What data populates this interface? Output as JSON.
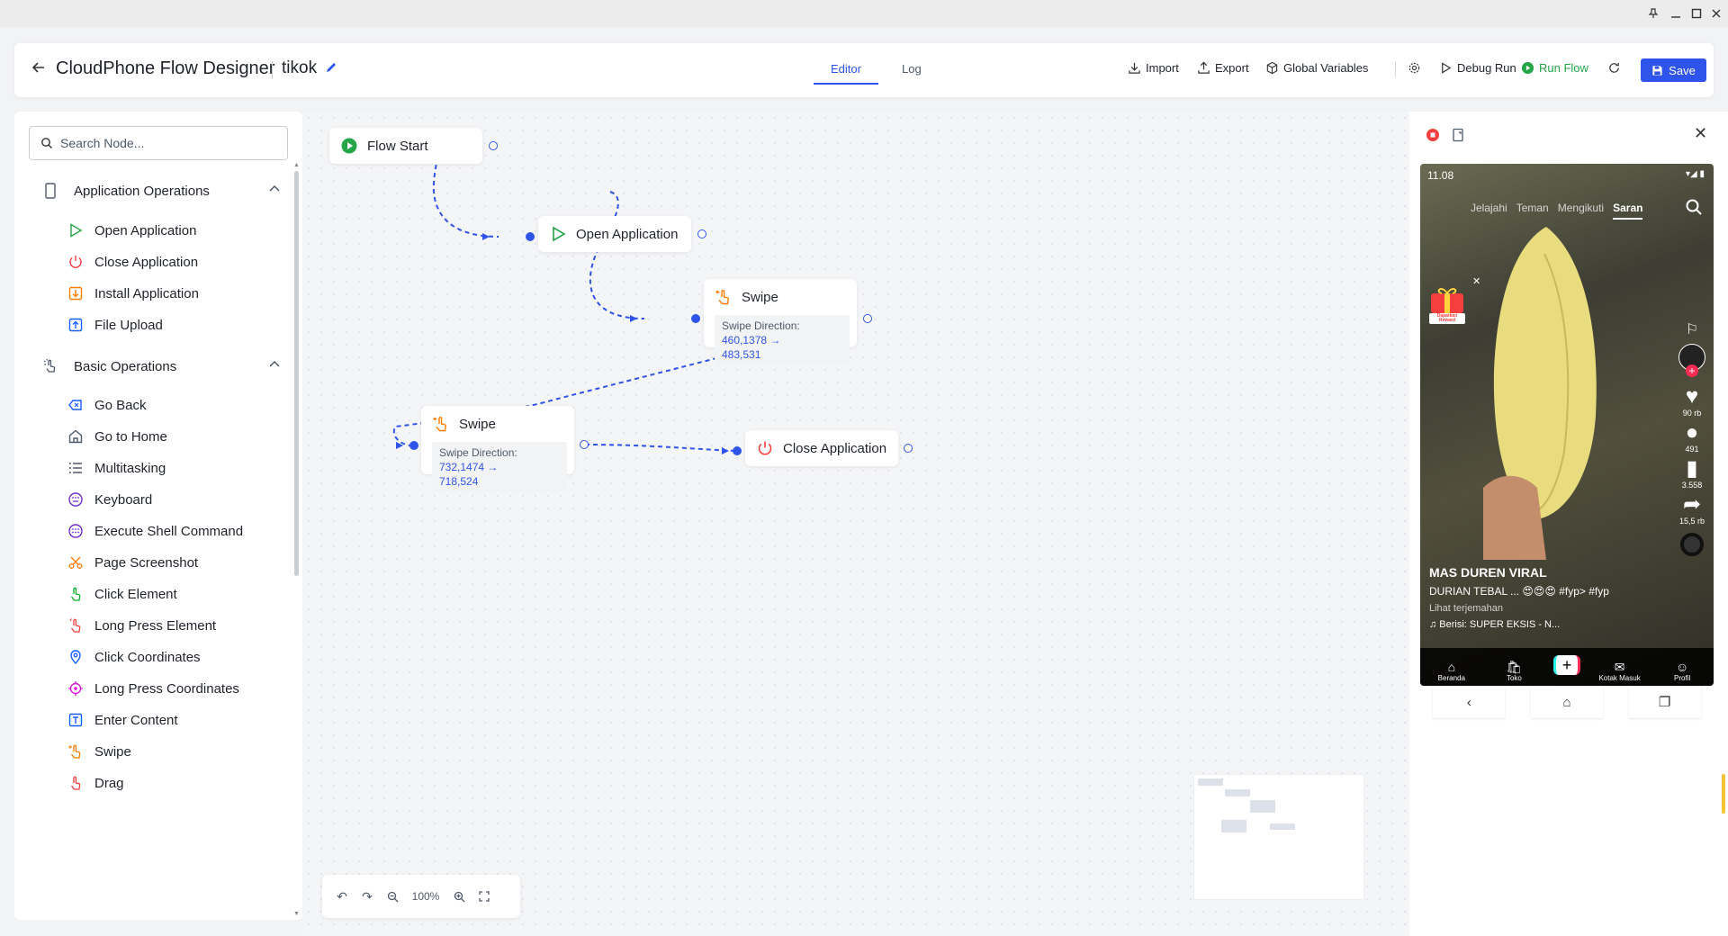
{
  "window": {
    "controls": [
      "pin-icon",
      "minimize-icon",
      "maximize-icon",
      "close-icon"
    ]
  },
  "header": {
    "title": "CloudPhone Flow Designer",
    "flow_name": "tikok",
    "tabs": [
      {
        "label": "Editor",
        "active": true
      },
      {
        "label": "Log",
        "active": false
      }
    ],
    "buttons": {
      "import": "Import",
      "export": "Export",
      "global_variables": "Global Variables",
      "debug_run": "Debug Run",
      "run_flow": "Run Flow",
      "save": "Save"
    },
    "colors": {
      "accent": "#2f54eb",
      "run": "#23a548"
    }
  },
  "sidebar": {
    "search_placeholder": "Search Node...",
    "groups": [
      {
        "label": "Application Operations",
        "items": [
          "Open Application",
          "Close Application",
          "Install Application",
          "File Upload"
        ]
      },
      {
        "label": "Basic Operations",
        "items": [
          "Go Back",
          "Go to Home",
          "Multitasking",
          "Keyboard",
          "Execute Shell Command",
          "Page Screenshot",
          "Click Element",
          "Long Press Element",
          "Click Coordinates",
          "Long Press Coordinates",
          "Enter Content",
          "Swipe",
          "Drag"
        ]
      }
    ]
  },
  "canvas": {
    "nodes": {
      "flow_start": {
        "title": "Flow Start"
      },
      "open_app": {
        "title": "Open Application"
      },
      "swipe1": {
        "title": "Swipe",
        "detail_label": "Swipe Direction: ",
        "value_a": "460,1378 →",
        "value_b": "483,531"
      },
      "swipe2": {
        "title": "Swipe",
        "detail_label": "Swipe Direction: ",
        "value_a": "732,1474 →",
        "value_b": "718,524"
      },
      "close_app": {
        "title": "Close Application"
      }
    },
    "zoom": "100%"
  },
  "phone": {
    "status_time": "11.08",
    "tabs": [
      "Jelajahi",
      "Teman",
      "Mengikuti",
      "Saran"
    ],
    "active_tab": "Saran",
    "reward_label": "Dapatkan Reward",
    "likes": "90 rb",
    "comments": "491",
    "bookmarks": "3.558",
    "shares": "15,5 rb",
    "author": "MAS DUREN VIRAL",
    "caption": "DURIAN TEBAL ... 😍😍😍 #fyp> #fyp",
    "translate": "Lihat terjemahan",
    "music": "♫ Berisi: SUPER EKSIS - N...",
    "nav": [
      "Beranda",
      "Toko",
      "",
      "Kotak Masuk",
      "Profil"
    ]
  }
}
